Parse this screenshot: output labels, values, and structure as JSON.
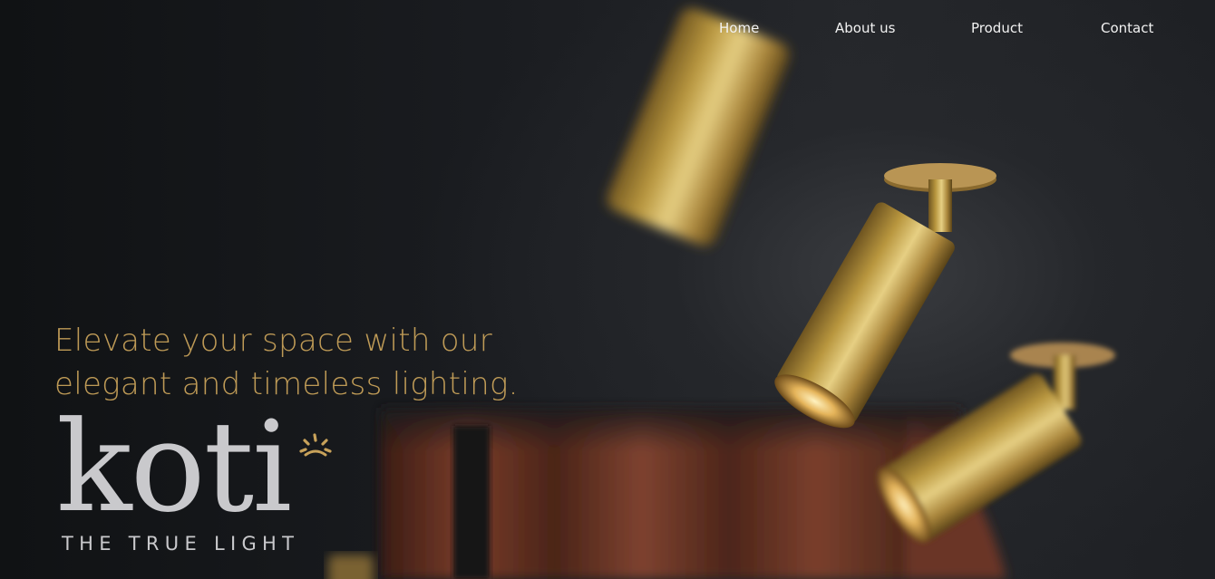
{
  "nav": {
    "items": [
      {
        "label": "Home"
      },
      {
        "label": "About us"
      },
      {
        "label": "Product"
      },
      {
        "label": "Contact"
      }
    ]
  },
  "hero": {
    "tagline_line1": "Elevate your space with our",
    "tagline_line2": "elegant and timeless lighting."
  },
  "brand": {
    "wordmark": "koti",
    "slogan": "THE TRUE LIGHT",
    "logo_icon": "sun-rays-icon"
  },
  "colors": {
    "accent_gold": "#c8a25a",
    "logo_gray": "#c9c9cc",
    "nav_text": "#f2f2f2",
    "background": "#17191c",
    "curtain": "#6a3426"
  }
}
